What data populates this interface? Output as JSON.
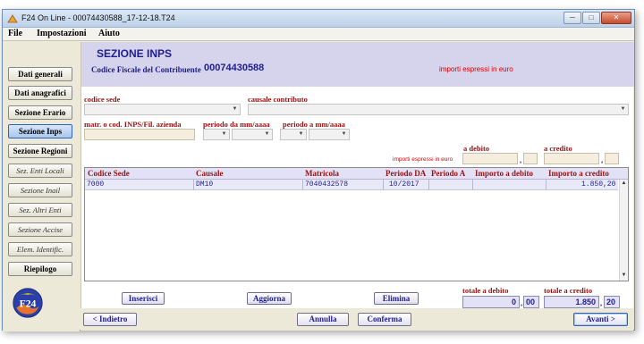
{
  "window": {
    "title": "F24 On Line - 00074430588_17-12-18.T24",
    "buttons": [
      "─",
      "□",
      "✕"
    ]
  },
  "menu": {
    "items": [
      "File",
      "Impostazioni",
      "Aiuto"
    ]
  },
  "sidebar": {
    "items": [
      {
        "label": "Dati generali"
      },
      {
        "label": "Dati anagrafici"
      },
      {
        "label": "Sezione Erario"
      },
      {
        "label": "Sezione Inps"
      },
      {
        "label": "Sezione Regioni"
      },
      {
        "label": "Sez. Enti Locali"
      },
      {
        "label": "Sezione Inail"
      },
      {
        "label": "Sez. Altri Enti"
      },
      {
        "label": "Sezione Accise"
      },
      {
        "label": "Elem. Identific."
      },
      {
        "label": "Riepilogo"
      }
    ],
    "active_index": 3,
    "logo_text": "F24"
  },
  "header": {
    "section_title": "SEZIONE INPS",
    "cf_label": "Codice Fiscale del Contribuente",
    "cf_value": "00074430588",
    "euro_note": "importi espressi in euro"
  },
  "form": {
    "codice_sede_label": "codice sede",
    "causale_label": "causale contributo",
    "matricola_label": "matr. o cod. INPS/Fil. azienda",
    "periodo_da_label": "periodo da mm/aaaa",
    "periodo_a_label": "periodo a mm/aaaa",
    "a_debito_label": "a debito",
    "a_credito_label": "a credito",
    "euro_note_small": "importi espressi in euro",
    "comma": ","
  },
  "table": {
    "columns": [
      "Codice Sede",
      "Causale",
      "Matricola",
      "Periodo DA",
      "Periodo A",
      "Importo a debito",
      "Importo a credito"
    ],
    "rows": [
      [
        "7000",
        "DM10",
        "7040432578",
        "10/2017",
        "",
        "",
        "1.850,20"
      ]
    ]
  },
  "actions": {
    "inserisci": "Inserisci",
    "aggiorna": "Aggiorna",
    "elimina": "Elimina"
  },
  "totals": {
    "debito_label": "totale a debito",
    "credito_label": "totale a credito",
    "debito_int": "0",
    "debito_dec": "00",
    "credito_int": "1.850",
    "credito_dec": "20",
    "comma": ","
  },
  "footer": {
    "back": "< Indietro",
    "annulla": "Annulla",
    "conferma": "Conferma",
    "next": "Avanti >"
  }
}
